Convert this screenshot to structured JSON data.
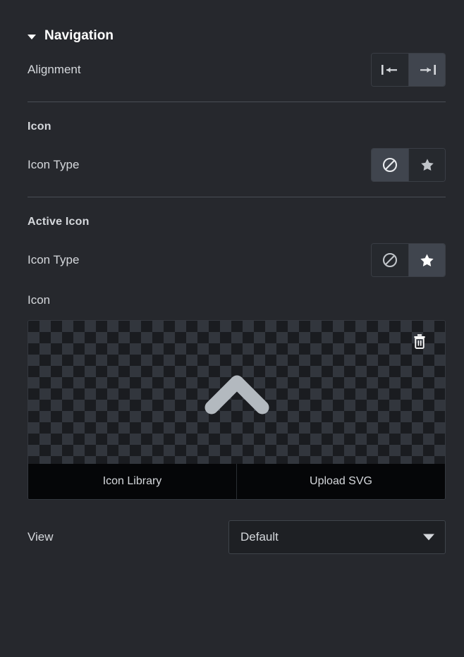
{
  "panel": {
    "section": {
      "title": "Navigation",
      "collapse_icon": "caret-down-icon",
      "expanded": true
    },
    "alignment_row": {
      "label": "Alignment",
      "options": [
        {
          "value": "left",
          "icon": "align-left-icon",
          "selected": false
        },
        {
          "value": "right",
          "icon": "align-right-icon",
          "selected": true
        }
      ]
    },
    "icon_group": {
      "heading": "Icon",
      "icon_type_row": {
        "label": "Icon Type",
        "options": [
          {
            "value": "none",
            "icon": "ban-icon",
            "selected": true
          },
          {
            "value": "icon",
            "icon": "star-icon",
            "selected": false
          }
        ]
      }
    },
    "active_icon_group": {
      "heading": "Active Icon",
      "icon_type_row": {
        "label": "Icon Type",
        "options": [
          {
            "value": "none",
            "icon": "ban-icon",
            "selected": false
          },
          {
            "value": "icon",
            "icon": "star-icon",
            "selected": true
          }
        ]
      },
      "icon_field": {
        "label": "Icon",
        "preview_icon": "chevron-up-icon",
        "preview_icon_color": "#b3b9bf",
        "delete_icon": "trash-icon",
        "actions": [
          {
            "label": "Icon Library"
          },
          {
            "label": "Upload SVG"
          }
        ]
      }
    },
    "view_row": {
      "label": "View",
      "value": "Default",
      "caret_icon": "caret-down-icon"
    },
    "colors": {
      "background": "#26282d",
      "text": "#d5d8dc",
      "heading": "#ffffff",
      "selected_button": "#40454e",
      "unselected_button": "#26292e",
      "divider": "#4a4e55",
      "action_bar": "#050608"
    }
  }
}
